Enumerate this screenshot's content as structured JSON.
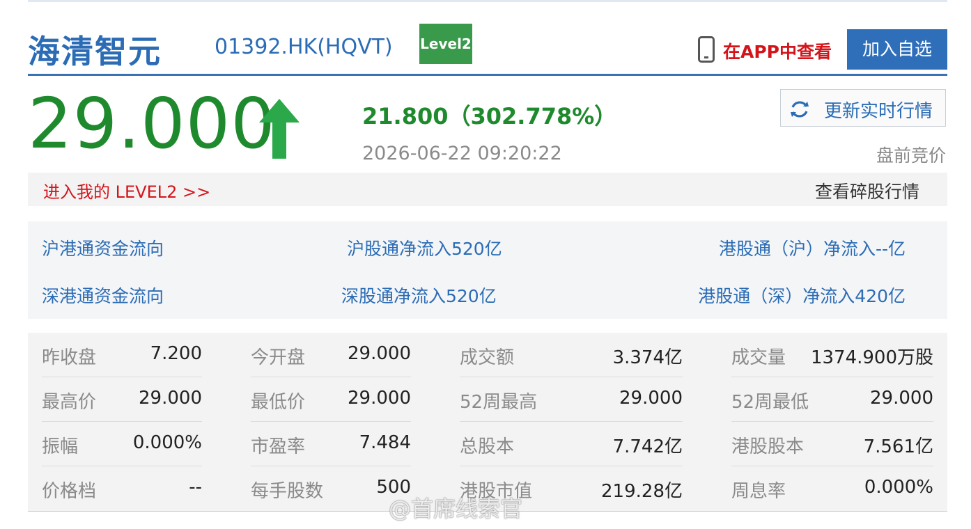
{
  "header": {
    "stock_name": "海清智元",
    "stock_code": "01392.HK(HQVT)",
    "level_badge": "Level2",
    "app_link": "在APP中查看",
    "add_button": "加入自选"
  },
  "quote": {
    "price": "29.000",
    "change": "21.800（302.778%）",
    "timestamp": "2026-06-22 09:20:22",
    "refresh_button": "更新实时行情",
    "session": "盘前竞价",
    "trend": "up",
    "up_color": "#1e8a2d"
  },
  "level2_bar": {
    "link": "进入我的 LEVEL2 >>",
    "odd_lot_link": "查看碎股行情"
  },
  "flows": {
    "row1": [
      "沪港通资金流向",
      "沪股通净流入520亿",
      "港股通（沪）净流入--亿"
    ],
    "row2": [
      "深港通资金流向",
      "深股通净流入520亿",
      "港股通（深）净流入420亿"
    ]
  },
  "stats": [
    [
      [
        "昨收盘",
        "7.200"
      ],
      [
        "今开盘",
        "29.000"
      ],
      [
        "成交额",
        "3.374亿"
      ],
      [
        "成交量",
        "1374.900万股"
      ]
    ],
    [
      [
        "最高价",
        "29.000"
      ],
      [
        "最低价",
        "29.000"
      ],
      [
        "52周最高",
        "29.000"
      ],
      [
        "52周最低",
        "29.000"
      ]
    ],
    [
      [
        "振幅",
        "0.000%"
      ],
      [
        "市盈率",
        "7.484"
      ],
      [
        "总股本",
        "7.742亿"
      ],
      [
        "港股股本",
        "7.561亿"
      ]
    ],
    [
      [
        "价格档",
        "--"
      ],
      [
        "每手股数",
        "500"
      ],
      [
        "港股市值",
        "219.28亿"
      ],
      [
        "周息率",
        "0.000%"
      ]
    ]
  ],
  "watermark": "@首席线索官",
  "colors": {
    "brand_blue": "#2b6cb5",
    "link_red": "#d4141b",
    "badge_green": "#3a9a4b"
  }
}
